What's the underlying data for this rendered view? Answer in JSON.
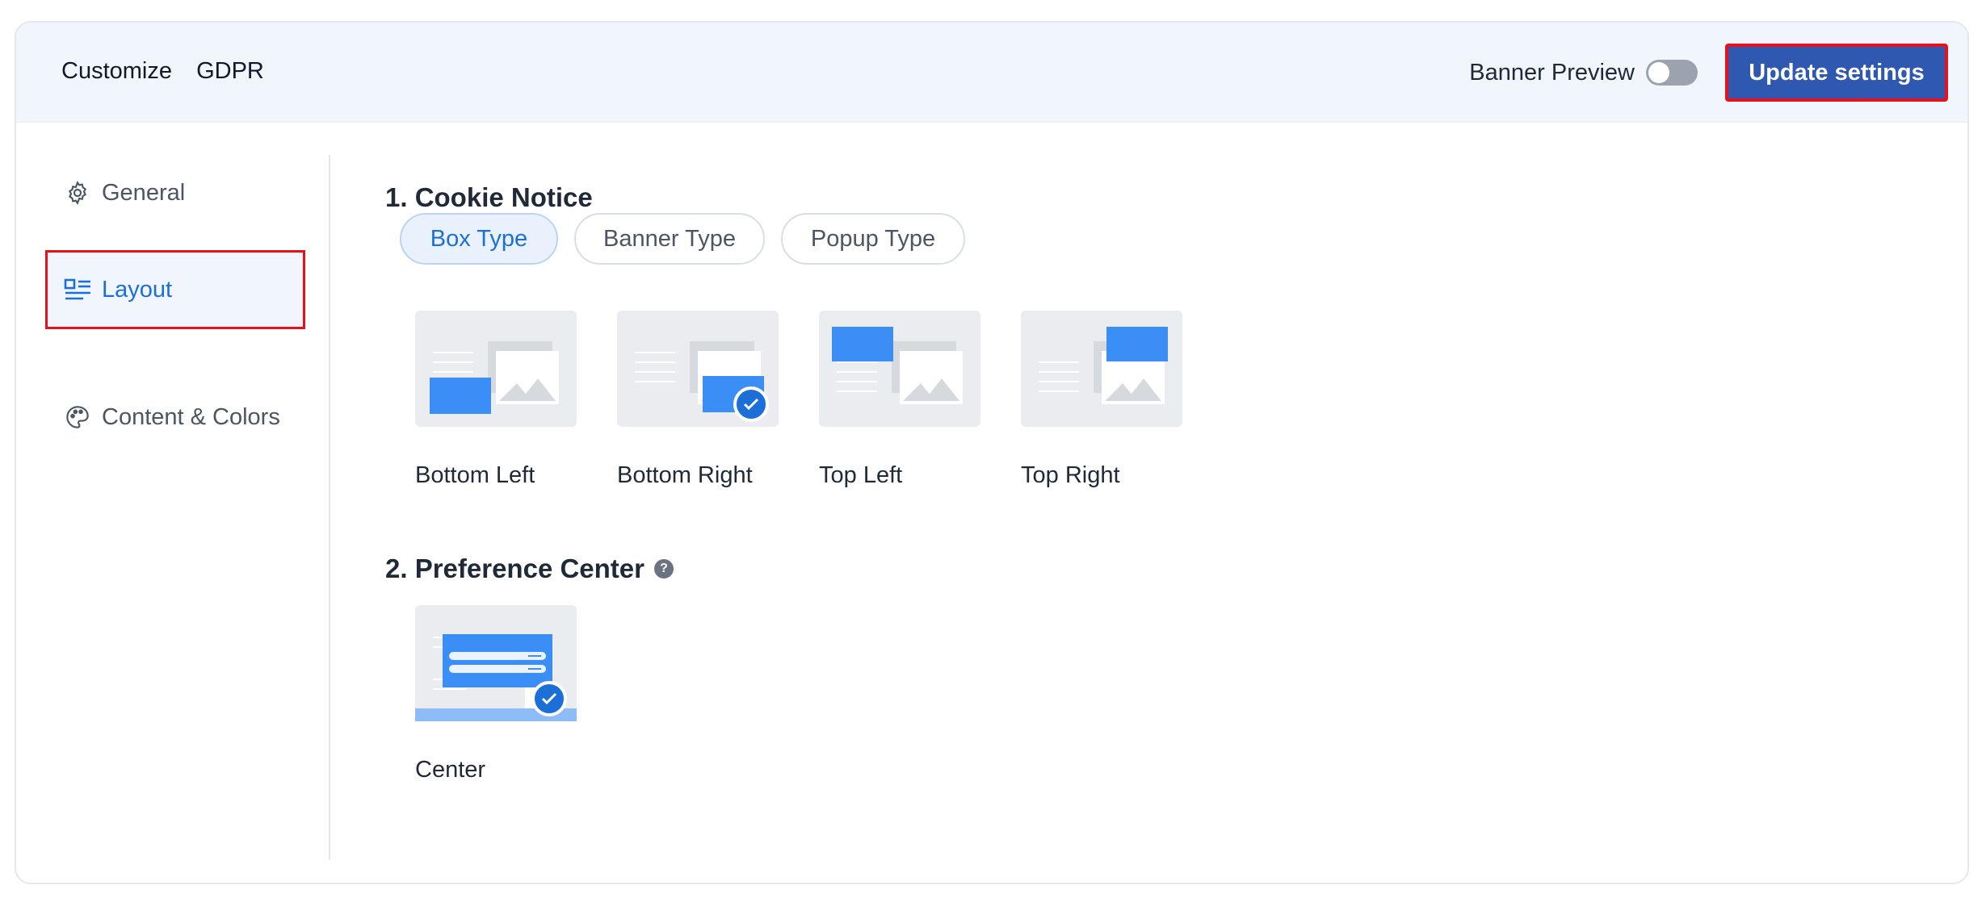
{
  "header": {
    "title": "Customize",
    "subtitle": "GDPR",
    "preview_label": "Banner Preview",
    "preview_enabled": false,
    "update_button": "Update settings"
  },
  "sidebar": {
    "items": [
      {
        "label": "General",
        "icon": "gear-icon",
        "active": false
      },
      {
        "label": "Layout",
        "icon": "layout-icon",
        "active": true
      },
      {
        "label": "Content & Colors",
        "icon": "palette-icon",
        "active": false
      }
    ]
  },
  "cookie_notice": {
    "title": "1. Cookie Notice",
    "tabs": [
      {
        "label": "Box Type",
        "active": true
      },
      {
        "label": "Banner Type",
        "active": false
      },
      {
        "label": "Popup Type",
        "active": false
      }
    ],
    "options": [
      {
        "label": "Bottom Left",
        "selected": false
      },
      {
        "label": "Bottom Right",
        "selected": true
      },
      {
        "label": "Top Left",
        "selected": false
      },
      {
        "label": "Top Right",
        "selected": false
      }
    ]
  },
  "preference_center": {
    "title": "2. Preference Center",
    "help_icon": "?",
    "options": [
      {
        "label": "Center",
        "selected": true
      }
    ]
  },
  "colors": {
    "accent": "#1d6fd8",
    "primary_button": "#2f58b0",
    "header_bg": "#f1f6fd",
    "thumb_bg": "#eaecef",
    "thumb_blue": "#3a8ef5"
  }
}
